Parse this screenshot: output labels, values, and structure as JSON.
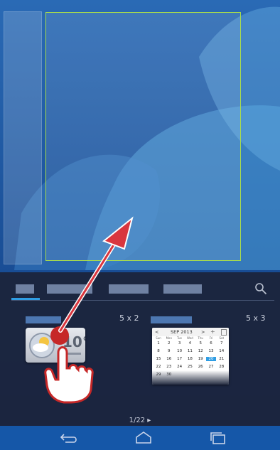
{
  "palette": {
    "accent": "#2f9de3",
    "drop_frame": "#a9dc4b",
    "arrow": "#d9363e",
    "touch_dot": "#c62828"
  },
  "widget_picker": {
    "category_tabs": [
      {
        "name": "tab-category-1",
        "selected": true
      },
      {
        "name": "tab-category-2"
      },
      {
        "name": "tab-category-3"
      },
      {
        "name": "tab-category-4"
      }
    ],
    "search_icon": "search-icon",
    "widgets": [
      {
        "size": "5 x 2",
        "preview": "weather-clock",
        "temp": "10°"
      },
      {
        "size": "5 x 3",
        "preview": "calendar"
      }
    ],
    "page_indicator": "1/22 ▸"
  },
  "calendar": {
    "month": "SEP 2013",
    "prev": "<",
    "next": ">",
    "add": "+",
    "weekdays": [
      "Sun",
      "Mon",
      "Tue",
      "Wed",
      "Thu",
      "Fri",
      "Sat"
    ],
    "days": [
      "1",
      "2",
      "3",
      "4",
      "5",
      "6",
      "7",
      "8",
      "9",
      "10",
      "11",
      "12",
      "13",
      "14",
      "15",
      "16",
      "17",
      "18",
      "19",
      "20",
      "21",
      "22",
      "23",
      "24",
      "25",
      "26",
      "27",
      "28",
      "29",
      "30"
    ],
    "today": "20"
  },
  "navbar": {
    "icons": [
      "back-icon",
      "home-icon",
      "recents-icon"
    ]
  },
  "gesture": {
    "icons": [
      "hand-icon",
      "drag-arrow-icon"
    ]
  }
}
